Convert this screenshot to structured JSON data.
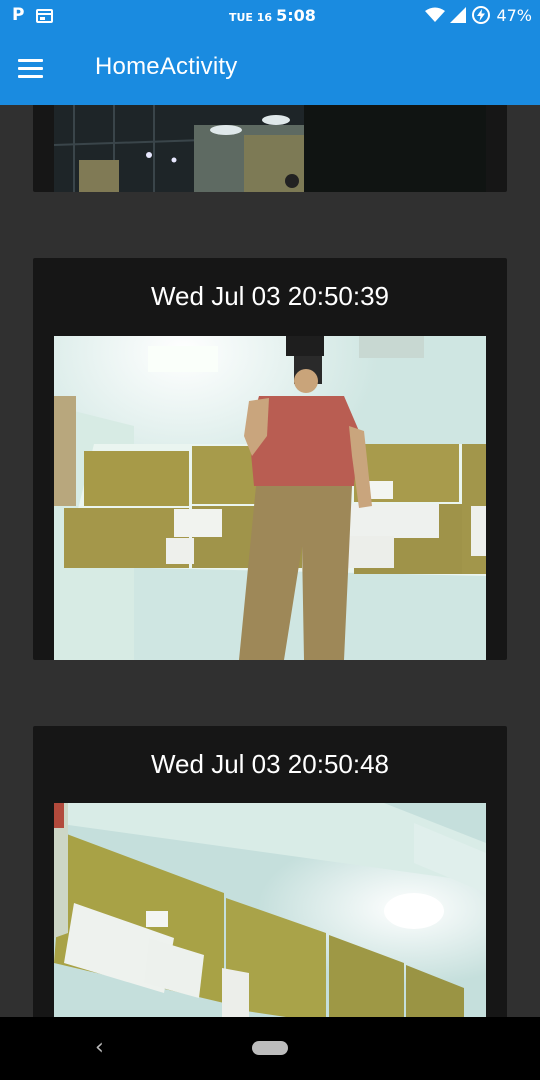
{
  "status_bar": {
    "day": "TUE 16",
    "time": "5:08",
    "battery": "47%",
    "icons": [
      "parking-icon",
      "calendar-icon",
      "wifi-icon",
      "signal-icon",
      "battery-saver-icon"
    ]
  },
  "app_bar": {
    "title": "HomeActivity",
    "menu_icon": "hamburger-menu-icon"
  },
  "cards": [
    {
      "timestamp": "",
      "photo": "office-ceiling-lights-photo"
    },
    {
      "timestamp": "Wed Jul 03 20:50:39",
      "photo": "person-mirror-selfie-photo"
    },
    {
      "timestamp": "Wed Jul 03 20:50:48",
      "photo": "notice-board-ceiling-photo"
    }
  ],
  "nav_bar": {
    "back_icon": "back-chevron-icon",
    "home_icon": "home-pill-icon"
  },
  "colors": {
    "primary": "#1a8be0",
    "background": "#303030",
    "card": "#161616"
  }
}
